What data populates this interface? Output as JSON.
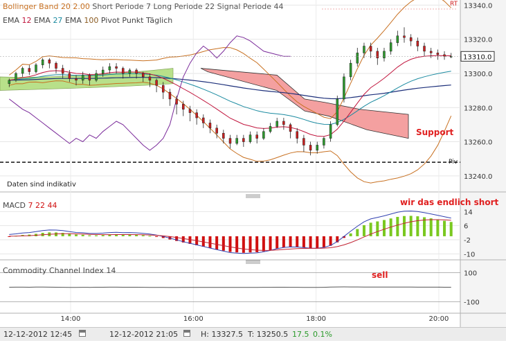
{
  "main_panel": {
    "header_line1": {
      "bb_label": "Bollinger Band",
      "bb_params": "20 2.00",
      "macd_params": "Short Periode 7   Long Periode 22   Signal Periode 44",
      "rt_badge": "RT"
    },
    "header_line2": {
      "ema1_label": "EMA",
      "ema1_value": "12",
      "ema2_label": "EMA",
      "ema2_value": "27",
      "ema3_label": "EMA",
      "ema3_value": "100",
      "pivot_label": "Pivot Punkt  Täglich"
    },
    "disclaimer": "Daten sind indikativ",
    "pivot_tag": "Piv",
    "annotation_support": "Support",
    "current_price_label": "13310.0"
  },
  "macd_panel": {
    "title": "MACD",
    "p1": "7",
    "p2": "22",
    "p3": "44",
    "annotation": "wir das endlich short"
  },
  "cci_panel": {
    "title": "Commodity Channel Index",
    "period": "14",
    "annotation": "sell"
  },
  "footer": {
    "start": "12-12-2012 12:45",
    "end": "12-12-2012 21:05",
    "high": "H: 13327.5",
    "low": "T: 13250.5",
    "change_abs": "17.5",
    "change_pct": "0.1%"
  },
  "colors": {
    "ema12": "#c0143c",
    "ema27": "#1a8aa0",
    "ema100": "#1c2f7a",
    "bollinger": "#c87020",
    "cci": "#7a2a9a",
    "candle_up": "#2e9a2e",
    "candle_down": "#c82020",
    "macd_pos": "#7ac820",
    "macd_neg": "#d01010",
    "annotation": "#e02020",
    "cloud_green": "#b8e08a",
    "cloud_red": "#f4a0a0"
  },
  "chart_data": [
    {
      "type": "line",
      "panel": "price",
      "y_ticks": [
        13240,
        13260,
        13280,
        13300,
        13320,
        13340
      ],
      "ylim": [
        13231,
        13343
      ],
      "x_ticks": [
        "14:00",
        "16:00",
        "18:00",
        "20:00"
      ],
      "x_tick_times": [
        14,
        16,
        18,
        20
      ],
      "xlim": [
        12.85,
        20.35
      ],
      "pivot": 13248,
      "current_price": 13310,
      "last_candle": 13310,
      "candles": [
        [
          13294,
          13296,
          13292,
          13297
        ],
        [
          13296,
          13300,
          13295,
          13301
        ],
        [
          13300,
          13303,
          13298,
          13304
        ],
        [
          13303,
          13301,
          13299,
          13305
        ],
        [
          13301,
          13305,
          13300,
          13306
        ],
        [
          13305,
          13308,
          13303,
          13309
        ],
        [
          13308,
          13306,
          13303,
          13309
        ],
        [
          13306,
          13303,
          13300,
          13307
        ],
        [
          13303,
          13300,
          13297,
          13305
        ],
        [
          13300,
          13297,
          13295,
          13302
        ],
        [
          13297,
          13296,
          13293,
          13299
        ],
        [
          13296,
          13299,
          13294,
          13301
        ],
        [
          13299,
          13296,
          13293,
          13300
        ],
        [
          13296,
          13300,
          13295,
          13302
        ],
        [
          13300,
          13302,
          13298,
          13304
        ],
        [
          13302,
          13304,
          13300,
          13306
        ],
        [
          13304,
          13303,
          13300,
          13306
        ],
        [
          13303,
          13300,
          13297,
          13304
        ],
        [
          13300,
          13302,
          13298,
          13303
        ],
        [
          13302,
          13300,
          13297,
          13303
        ],
        [
          13300,
          13298,
          13295,
          13301
        ],
        [
          13298,
          13296,
          13292,
          13300
        ],
        [
          13296,
          13293,
          13289,
          13297
        ],
        [
          13293,
          13289,
          13285,
          13295
        ],
        [
          13289,
          13285,
          13281,
          13291
        ],
        [
          13285,
          13282,
          13276,
          13287
        ],
        [
          13282,
          13279,
          13275,
          13284
        ],
        [
          13279,
          13277,
          13272,
          13281
        ],
        [
          13277,
          13274,
          13270,
          13279
        ],
        [
          13274,
          13271,
          13268,
          13276
        ],
        [
          13271,
          13268,
          13265,
          13273
        ],
        [
          13268,
          13265,
          13262,
          13270
        ],
        [
          13265,
          13262,
          13259,
          13267
        ],
        [
          13262,
          13259,
          13256,
          13264
        ],
        [
          13259,
          13262,
          13258,
          13264
        ],
        [
          13262,
          13260,
          13257,
          13264
        ],
        [
          13260,
          13264,
          13259,
          13266
        ],
        [
          13264,
          13262,
          13259,
          13266
        ],
        [
          13262,
          13266,
          13261,
          13268
        ],
        [
          13266,
          13269,
          13265,
          13271
        ],
        [
          13269,
          13272,
          13268,
          13274
        ],
        [
          13272,
          13270,
          13267,
          13274
        ],
        [
          13270,
          13266,
          13262,
          13271
        ],
        [
          13266,
          13262,
          13259,
          13268
        ],
        [
          13262,
          13258,
          13254,
          13264
        ],
        [
          13258,
          13255,
          13252,
          13260
        ],
        [
          13255,
          13258,
          13253,
          13260
        ],
        [
          13258,
          13262,
          13256,
          13263
        ],
        [
          13262,
          13270,
          13260,
          13272
        ],
        [
          13270,
          13285,
          13269,
          13287
        ],
        [
          13285,
          13298,
          13283,
          13300
        ],
        [
          13298,
          13306,
          13296,
          13308
        ],
        [
          13306,
          13312,
          13304,
          13315
        ],
        [
          13312,
          13316,
          13309,
          13318
        ],
        [
          13316,
          13313,
          13309,
          13318
        ],
        [
          13313,
          13309,
          13305,
          13315
        ],
        [
          13309,
          13313,
          13307,
          13315
        ],
        [
          13313,
          13318,
          13311,
          13320
        ],
        [
          13318,
          13322,
          13316,
          13325
        ],
        [
          13322,
          13321,
          13318,
          13327
        ],
        [
          13321,
          13319,
          13316,
          13323
        ],
        [
          13319,
          13316,
          13313,
          13321
        ],
        [
          13316,
          13313,
          13310,
          13318
        ],
        [
          13313,
          13312,
          13309,
          13315
        ],
        [
          13312,
          13311,
          13308,
          13314
        ],
        [
          13311,
          13310,
          13308,
          13313
        ],
        [
          13310,
          13310,
          13309,
          13312
        ]
      ]
    },
    {
      "type": "bar",
      "panel": "macd",
      "y_ticks": [
        14,
        6,
        -2,
        -10
      ],
      "ylim": [
        -13,
        22
      ]
    },
    {
      "type": "line",
      "panel": "cci",
      "y_ticks": [
        100,
        -100
      ],
      "ylim": [
        -175,
        175
      ]
    }
  ]
}
